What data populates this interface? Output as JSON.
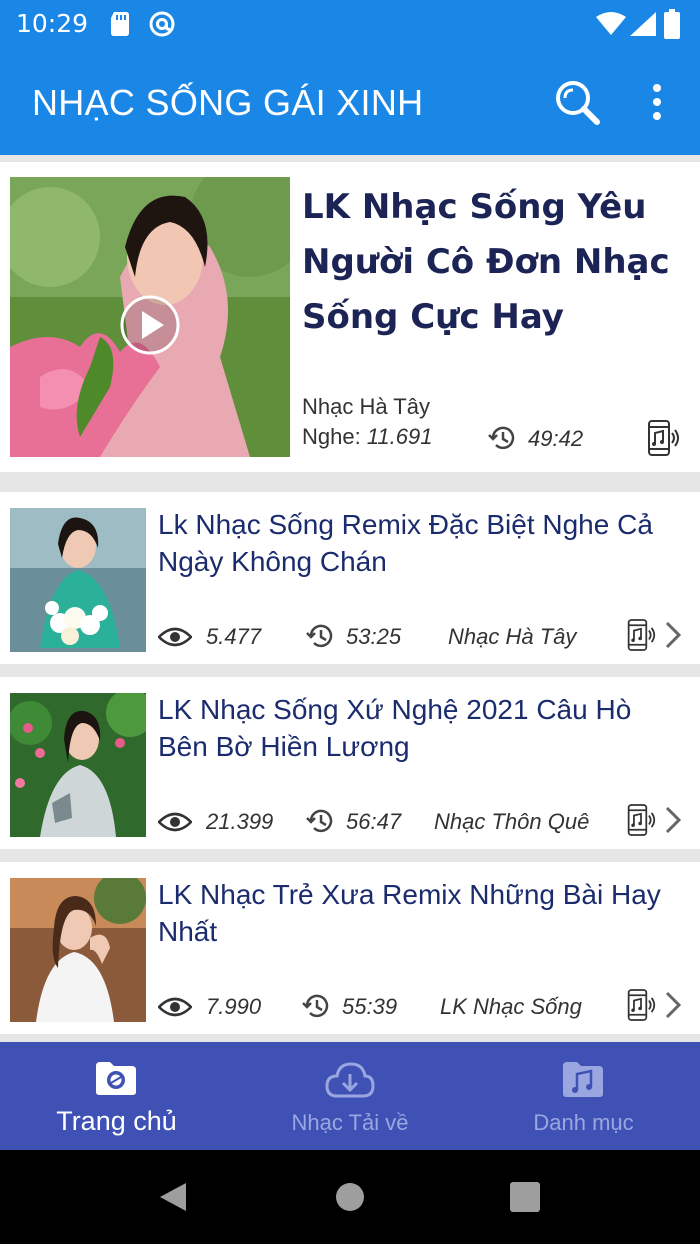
{
  "status_bar": {
    "time": "10:29"
  },
  "app_bar": {
    "title": "NHẠC SỐNG GÁI XINH"
  },
  "featured": {
    "title": "LK Nhạc Sống Yêu Người Cô Đơn Nhạc Sống Cực Hay",
    "channel": "Nhạc Hà Tây",
    "views_label": "Nghe: ",
    "views": "11.691",
    "duration": "49:42"
  },
  "items": [
    {
      "title": "Lk Nhạc Sống  Remix Đặc Biệt Nghe Cả Ngày Không Chán",
      "views": "5.477",
      "duration": "53:25",
      "channel": "Nhạc Hà Tây"
    },
    {
      "title": "LK Nhạc Sống Xứ Nghệ 2021 Câu Hò Bên Bờ Hiền Lương",
      "views": "21.399",
      "duration": "56:47",
      "channel": "Nhạc Thôn Quê"
    },
    {
      "title": "LK Nhạc Trẻ Xưa Remix Những Bài Hay Nhất",
      "views": "7.990",
      "duration": "55:39",
      "channel": "LK Nhạc Sống"
    }
  ],
  "bottom_nav": {
    "items": [
      {
        "label": "Trang chủ",
        "icon": "camera-folder-icon",
        "active": true
      },
      {
        "label": "Nhạc Tải về",
        "icon": "cloud-download-icon",
        "active": false
      },
      {
        "label": "Danh mục",
        "icon": "music-folder-icon",
        "active": false
      }
    ]
  },
  "colors": {
    "primary": "#1a87e6",
    "nav": "#3f51b5",
    "title_text": "#1b2454",
    "item_text": "#1b2c6e"
  }
}
